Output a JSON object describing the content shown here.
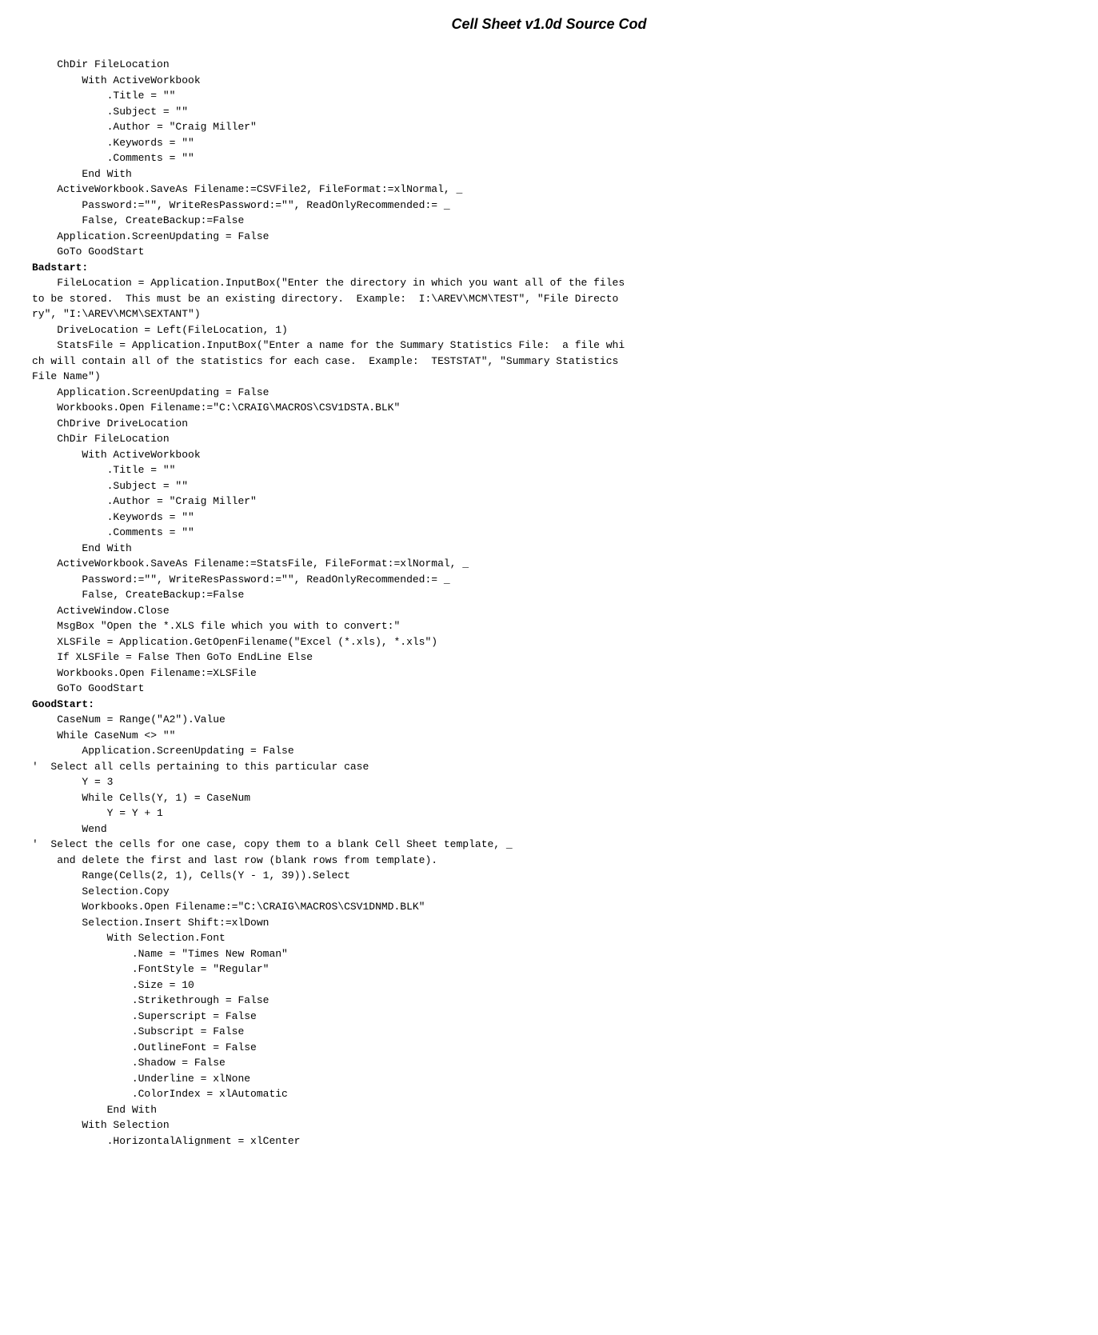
{
  "title": "Cell Sheet v1.0d Source Cod",
  "code": [
    "    ChDir FileLocation",
    "        With ActiveWorkbook",
    "            .Title = \"\"",
    "            .Subject = \"\"",
    "            .Author = \"Craig Miller\"",
    "            .Keywords = \"\"",
    "            .Comments = \"\"",
    "        End With",
    "    ActiveWorkbook.SaveAs Filename:=CSVFile2, FileFormat:=xlNormal, _",
    "        Password:=\"\", WriteResPassword:=\"\", ReadOnlyRecommended:= _",
    "        False, CreateBackup:=False",
    "    Application.ScreenUpdating = False",
    "    GoTo GoodStart",
    "Badstart:",
    "    FileLocation = Application.InputBox(\"Enter the directory in which you want all of the files",
    "to be stored.  This must be an existing directory.  Example:  I:\\AREV\\MCM\\TEST\", \"File Directo",
    "ry\", \"I:\\AREV\\MCM\\SEXTANT\")",
    "    DriveLocation = Left(FileLocation, 1)",
    "    StatsFile = Application.InputBox(\"Enter a name for the Summary Statistics File:  a file whi",
    "ch will contain all of the statistics for each case.  Example:  TESTSTAT\", \"Summary Statistics",
    "File Name\")",
    "    Application.ScreenUpdating = False",
    "    Workbooks.Open Filename:=\"C:\\CRAIG\\MACROS\\CSV1DSTA.BLK\"",
    "    ChDrive DriveLocation",
    "    ChDir FileLocation",
    "        With ActiveWorkbook",
    "            .Title = \"\"",
    "            .Subject = \"\"",
    "            .Author = \"Craig Miller\"",
    "            .Keywords = \"\"",
    "            .Comments = \"\"",
    "        End With",
    "    ActiveWorkbook.SaveAs Filename:=StatsFile, FileFormat:=xlNormal, _",
    "        Password:=\"\", WriteResPassword:=\"\", ReadOnlyRecommended:= _",
    "        False, CreateBackup:=False",
    "    ActiveWindow.Close",
    "    MsgBox \"Open the *.XLS file which you with to convert:\"",
    "    XLSFile = Application.GetOpenFilename(\"Excel (*.xls), *.xls\")",
    "    If XLSFile = False Then GoTo EndLine Else",
    "    Workbooks.Open Filename:=XLSFile",
    "    GoTo GoodStart",
    "GoodStart:",
    "    CaseNum = Range(\"A2\").Value",
    "    While CaseNum <> \"\"",
    "        Application.ScreenUpdating = False",
    "'  Select all cells pertaining to this particular case",
    "        Y = 3",
    "        While Cells(Y, 1) = CaseNum",
    "            Y = Y + 1",
    "        Wend",
    "'  Select the cells for one case, copy them to a blank Cell Sheet template, _",
    "    and delete the first and last row (blank rows from template).",
    "        Range(Cells(2, 1), Cells(Y - 1, 39)).Select",
    "        Selection.Copy",
    "        Workbooks.Open Filename:=\"C:\\CRAIG\\MACROS\\CSV1DNMD.BLK\"",
    "        Selection.Insert Shift:=xlDown",
    "            With Selection.Font",
    "                .Name = \"Times New Roman\"",
    "                .FontStyle = \"Regular\"",
    "                .Size = 10",
    "                .Strikethrough = False",
    "                .Superscript = False",
    "                .Subscript = False",
    "                .OutlineFont = False",
    "                .Shadow = False",
    "                .Underline = xlNone",
    "                .ColorIndex = xlAutomatic",
    "            End With",
    "        With Selection",
    "            .HorizontalAlignment = xlCenter"
  ]
}
